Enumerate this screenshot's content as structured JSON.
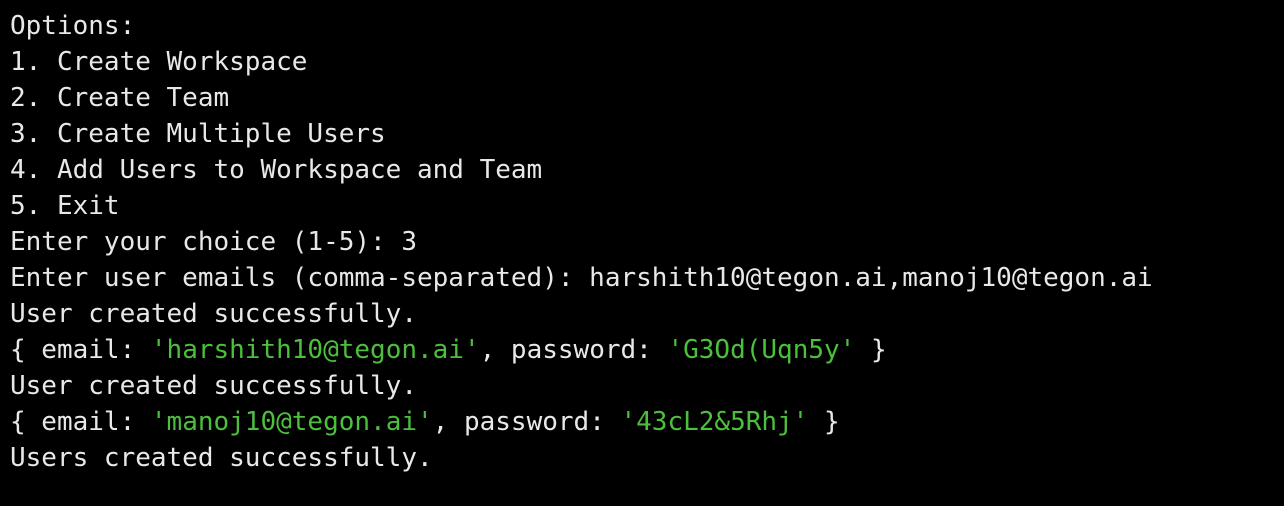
{
  "colors": {
    "background": "#000000",
    "text": "#e8e8e8",
    "string": "#4cbf3c"
  },
  "menu": {
    "heading": "Options:",
    "items": [
      "1. Create Workspace",
      "2. Create Team",
      "3. Create Multiple Users",
      "4. Add Users to Workspace and Team",
      "5. Exit"
    ]
  },
  "prompt": {
    "choice": "Enter your choice (1-5): 3",
    "emails": "Enter user emails (comma-separated): harshith10@tegon.ai,manoj10@tegon.ai"
  },
  "results": [
    {
      "status": "User created successfully.",
      "open": "{ email: ",
      "email": "'harshith10@tegon.ai'",
      "sep": ", password: ",
      "password": "'G3Od(Uqn5y'",
      "close": " }"
    },
    {
      "status": "User created successfully.",
      "open": "{ email: ",
      "email": "'manoj10@tegon.ai'",
      "sep": ", password: ",
      "password": "'43cL2&5Rhj'",
      "close": " }"
    }
  ],
  "final": "Users created successfully."
}
